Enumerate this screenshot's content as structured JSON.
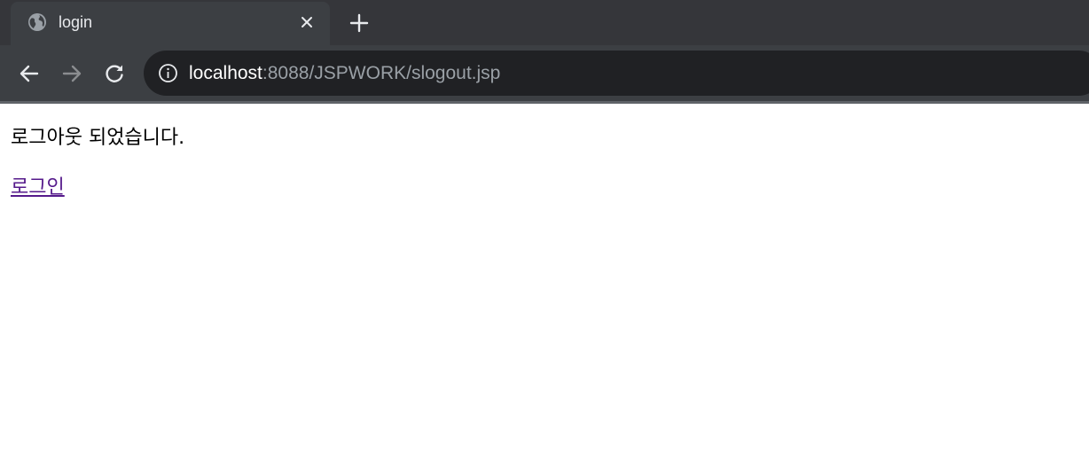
{
  "browser": {
    "tab": {
      "title": "login",
      "favicon": "globe-icon"
    },
    "address_bar": {
      "host": "localhost",
      "path": ":8088/JSPWORK/slogout.jsp"
    },
    "colors": {
      "tabstrip": "#35363a",
      "toolbar": "#3c3f43",
      "omnibox": "#202124",
      "visited_link": "#551a8b"
    }
  },
  "page": {
    "message": "로그아웃 되었습니다.",
    "login_link": "로그인"
  }
}
